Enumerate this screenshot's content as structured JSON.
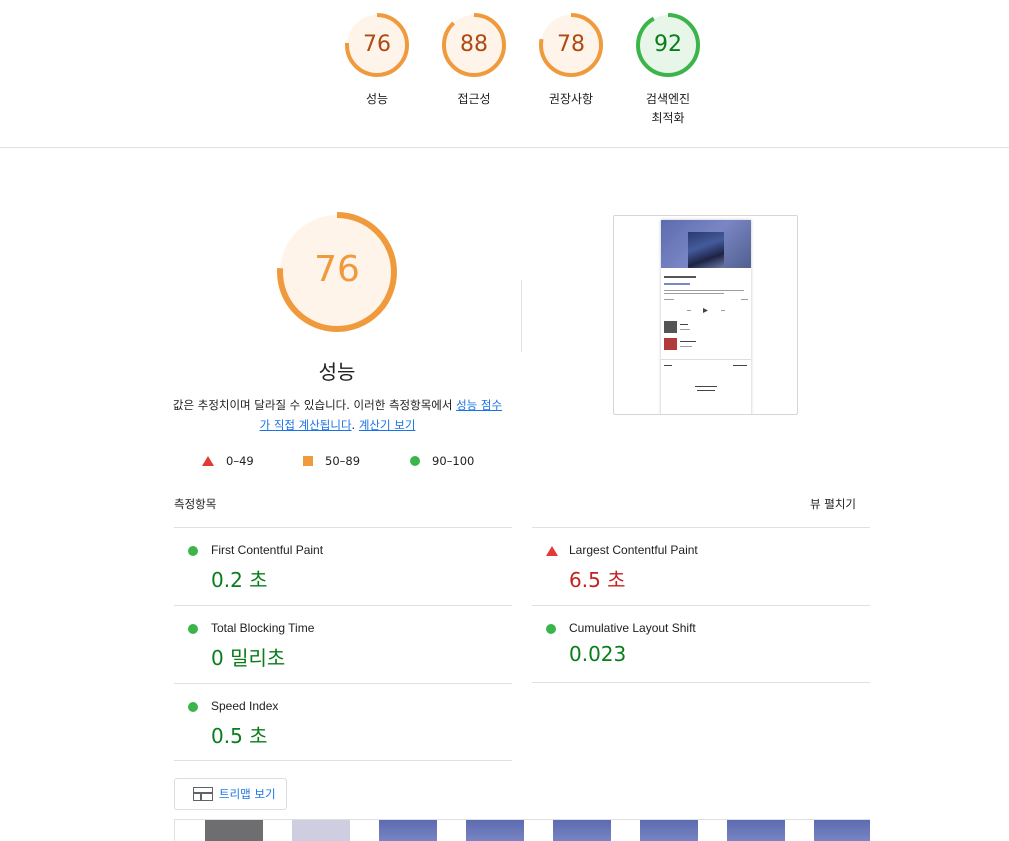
{
  "colors": {
    "average": "#f09a3e",
    "average_text": "#b04a13",
    "average_bg": "#fef4ea",
    "pass": "#3bb54a",
    "pass_text": "#0a7d1b",
    "pass_bg": "#e8f6ea",
    "fail": "#e53935",
    "fail_text": "#c5221f",
    "link": "#1a73e8"
  },
  "gauges": [
    {
      "score": "76",
      "label": "성능",
      "value": 0.76,
      "rating": "average"
    },
    {
      "score": "88",
      "label": "접근성",
      "value": 0.88,
      "rating": "average"
    },
    {
      "score": "78",
      "label": "권장사항",
      "value": 0.78,
      "rating": "average"
    },
    {
      "score": "92",
      "label": "검색엔진\n최적화",
      "value": 0.92,
      "rating": "pass"
    }
  ],
  "performance": {
    "score": "76",
    "value": 0.76,
    "title": "성능",
    "desc_prefix": "값은 추정치이며 달라질 수 있습니다. 이러한 측정항목에서 ",
    "desc_link1": "성능 점수가 직접 계산됩니다",
    "desc_mid": ". ",
    "desc_link2": "계산기 보기"
  },
  "legend": [
    {
      "icon": "triangle-icon",
      "range": "0–49"
    },
    {
      "icon": "square-icon",
      "range": "50–89"
    },
    {
      "icon": "circle-icon",
      "range": "90–100"
    }
  ],
  "metrics": {
    "title": "측정항목",
    "expand_label": "뷰 펼치기",
    "items": [
      {
        "name": "First Contentful Paint",
        "value": "0.2 초",
        "rating": "pass"
      },
      {
        "name": "Largest Contentful Paint",
        "value": "6.5 초",
        "rating": "fail"
      },
      {
        "name": "Total Blocking Time",
        "value": "0 밀리초",
        "rating": "pass"
      },
      {
        "name": "Cumulative Layout Shift",
        "value": "0.023",
        "rating": "pass"
      },
      {
        "name": "Speed Index",
        "value": "0.5 초",
        "rating": "pass"
      }
    ]
  },
  "treemap": {
    "label": "트리맵 보기"
  },
  "filmstrip": {
    "frames": [
      "blank-gray",
      "blank-lavender",
      "page",
      "page",
      "page",
      "page",
      "page",
      "page"
    ]
  }
}
